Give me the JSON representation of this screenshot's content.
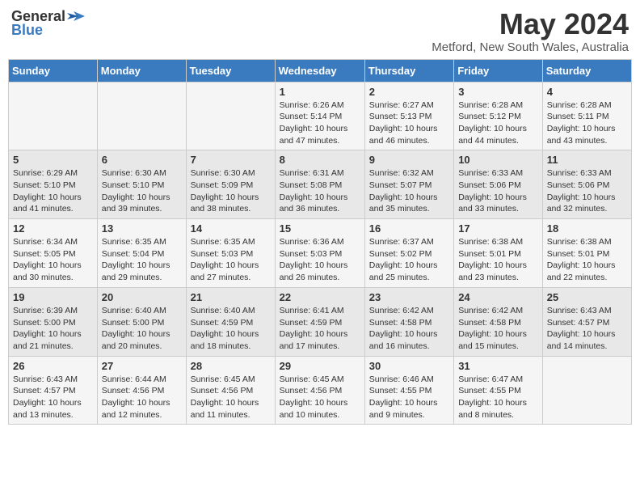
{
  "header": {
    "logo_general": "General",
    "logo_blue": "Blue",
    "title": "May 2024",
    "subtitle": "Metford, New South Wales, Australia"
  },
  "days_of_week": [
    "Sunday",
    "Monday",
    "Tuesday",
    "Wednesday",
    "Thursday",
    "Friday",
    "Saturday"
  ],
  "weeks": [
    [
      {
        "day": "",
        "info": ""
      },
      {
        "day": "",
        "info": ""
      },
      {
        "day": "",
        "info": ""
      },
      {
        "day": "1",
        "info": "Sunrise: 6:26 AM\nSunset: 5:14 PM\nDaylight: 10 hours and 47 minutes."
      },
      {
        "day": "2",
        "info": "Sunrise: 6:27 AM\nSunset: 5:13 PM\nDaylight: 10 hours and 46 minutes."
      },
      {
        "day": "3",
        "info": "Sunrise: 6:28 AM\nSunset: 5:12 PM\nDaylight: 10 hours and 44 minutes."
      },
      {
        "day": "4",
        "info": "Sunrise: 6:28 AM\nSunset: 5:11 PM\nDaylight: 10 hours and 43 minutes."
      }
    ],
    [
      {
        "day": "5",
        "info": "Sunrise: 6:29 AM\nSunset: 5:10 PM\nDaylight: 10 hours and 41 minutes."
      },
      {
        "day": "6",
        "info": "Sunrise: 6:30 AM\nSunset: 5:10 PM\nDaylight: 10 hours and 39 minutes."
      },
      {
        "day": "7",
        "info": "Sunrise: 6:30 AM\nSunset: 5:09 PM\nDaylight: 10 hours and 38 minutes."
      },
      {
        "day": "8",
        "info": "Sunrise: 6:31 AM\nSunset: 5:08 PM\nDaylight: 10 hours and 36 minutes."
      },
      {
        "day": "9",
        "info": "Sunrise: 6:32 AM\nSunset: 5:07 PM\nDaylight: 10 hours and 35 minutes."
      },
      {
        "day": "10",
        "info": "Sunrise: 6:33 AM\nSunset: 5:06 PM\nDaylight: 10 hours and 33 minutes."
      },
      {
        "day": "11",
        "info": "Sunrise: 6:33 AM\nSunset: 5:06 PM\nDaylight: 10 hours and 32 minutes."
      }
    ],
    [
      {
        "day": "12",
        "info": "Sunrise: 6:34 AM\nSunset: 5:05 PM\nDaylight: 10 hours and 30 minutes."
      },
      {
        "day": "13",
        "info": "Sunrise: 6:35 AM\nSunset: 5:04 PM\nDaylight: 10 hours and 29 minutes."
      },
      {
        "day": "14",
        "info": "Sunrise: 6:35 AM\nSunset: 5:03 PM\nDaylight: 10 hours and 27 minutes."
      },
      {
        "day": "15",
        "info": "Sunrise: 6:36 AM\nSunset: 5:03 PM\nDaylight: 10 hours and 26 minutes."
      },
      {
        "day": "16",
        "info": "Sunrise: 6:37 AM\nSunset: 5:02 PM\nDaylight: 10 hours and 25 minutes."
      },
      {
        "day": "17",
        "info": "Sunrise: 6:38 AM\nSunset: 5:01 PM\nDaylight: 10 hours and 23 minutes."
      },
      {
        "day": "18",
        "info": "Sunrise: 6:38 AM\nSunset: 5:01 PM\nDaylight: 10 hours and 22 minutes."
      }
    ],
    [
      {
        "day": "19",
        "info": "Sunrise: 6:39 AM\nSunset: 5:00 PM\nDaylight: 10 hours and 21 minutes."
      },
      {
        "day": "20",
        "info": "Sunrise: 6:40 AM\nSunset: 5:00 PM\nDaylight: 10 hours and 20 minutes."
      },
      {
        "day": "21",
        "info": "Sunrise: 6:40 AM\nSunset: 4:59 PM\nDaylight: 10 hours and 18 minutes."
      },
      {
        "day": "22",
        "info": "Sunrise: 6:41 AM\nSunset: 4:59 PM\nDaylight: 10 hours and 17 minutes."
      },
      {
        "day": "23",
        "info": "Sunrise: 6:42 AM\nSunset: 4:58 PM\nDaylight: 10 hours and 16 minutes."
      },
      {
        "day": "24",
        "info": "Sunrise: 6:42 AM\nSunset: 4:58 PM\nDaylight: 10 hours and 15 minutes."
      },
      {
        "day": "25",
        "info": "Sunrise: 6:43 AM\nSunset: 4:57 PM\nDaylight: 10 hours and 14 minutes."
      }
    ],
    [
      {
        "day": "26",
        "info": "Sunrise: 6:43 AM\nSunset: 4:57 PM\nDaylight: 10 hours and 13 minutes."
      },
      {
        "day": "27",
        "info": "Sunrise: 6:44 AM\nSunset: 4:56 PM\nDaylight: 10 hours and 12 minutes."
      },
      {
        "day": "28",
        "info": "Sunrise: 6:45 AM\nSunset: 4:56 PM\nDaylight: 10 hours and 11 minutes."
      },
      {
        "day": "29",
        "info": "Sunrise: 6:45 AM\nSunset: 4:56 PM\nDaylight: 10 hours and 10 minutes."
      },
      {
        "day": "30",
        "info": "Sunrise: 6:46 AM\nSunset: 4:55 PM\nDaylight: 10 hours and 9 minutes."
      },
      {
        "day": "31",
        "info": "Sunrise: 6:47 AM\nSunset: 4:55 PM\nDaylight: 10 hours and 8 minutes."
      },
      {
        "day": "",
        "info": ""
      }
    ]
  ]
}
